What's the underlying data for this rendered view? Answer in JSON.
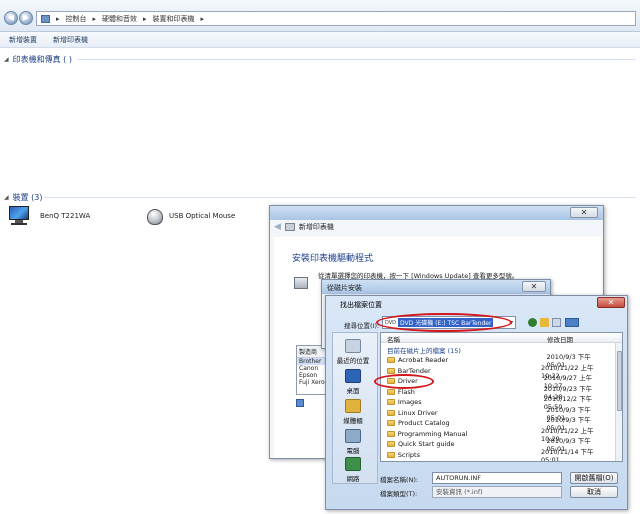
{
  "explorer": {
    "breadcrumb": [
      "控制台",
      "硬體和音效",
      "裝置和印表機"
    ],
    "toolbar": {
      "add_device": "新增裝置",
      "add_printer": "新增印表機"
    },
    "printers_group": "印表機和傳真 (  )",
    "devices_group": "裝置 (3)",
    "devices": [
      {
        "name": "BenQ T221WA"
      },
      {
        "name": "USB Optical Mouse"
      }
    ]
  },
  "add_printer_window": {
    "subtitle": "新增印表機",
    "heading": "安裝印表機驅動程式",
    "instruction": "從清單選擇您的印表機，按一下 [Windows Update] 查看更多型號。",
    "manufacturer_label": "製造商",
    "manufacturers": [
      "Brother",
      "Canon",
      "Epson",
      "Fuji Xerox"
    ]
  },
  "install_from_disk": {
    "title": "從磁片安裝"
  },
  "file_dialog": {
    "title": "找出檔案位置",
    "lookin_label": "搜尋位置(I):",
    "lookin_value": "DVD 光碟機 (E:) TSC BarTender",
    "col_name": "名稱",
    "col_date": "修改日期",
    "section_label": "目前在磁片上的檔案 (15)",
    "files": [
      {
        "name": "Acrobat Reader",
        "date": "2010/9/3 下午 05:01"
      },
      {
        "name": "BarTender",
        "date": "2010/11/22 上午 10:22"
      },
      {
        "name": "Driver",
        "date": "2010/9/27 上午 10:27"
      },
      {
        "name": "Flash",
        "date": "2010/9/23 下午 04:28"
      },
      {
        "name": "Images",
        "date": "2010/12/2 下午 05:50"
      },
      {
        "name": "Linux Driver",
        "date": "2010/9/3 下午 05:01"
      },
      {
        "name": "Product Catalog",
        "date": "2010/9/3 下午 05:01"
      },
      {
        "name": "Programming Manual",
        "date": "2010/11/22 上午 10:29"
      },
      {
        "name": "Quick Start guide",
        "date": "2010/9/3 下午 05:01"
      },
      {
        "name": "Scripts",
        "date": "2010/11/14 下午 05:01"
      }
    ],
    "places": [
      "最近的位置",
      "桌面",
      "媒體櫃",
      "電腦",
      "網路"
    ],
    "filename_label": "檔案名稱(N):",
    "filename_value": "AUTORUN.INF",
    "filetype_label": "檔案類型(T):",
    "filetype_value": "安裝資訊 (*.inf)",
    "open_button": "開啟舊檔(O)",
    "cancel_button": "取消"
  }
}
